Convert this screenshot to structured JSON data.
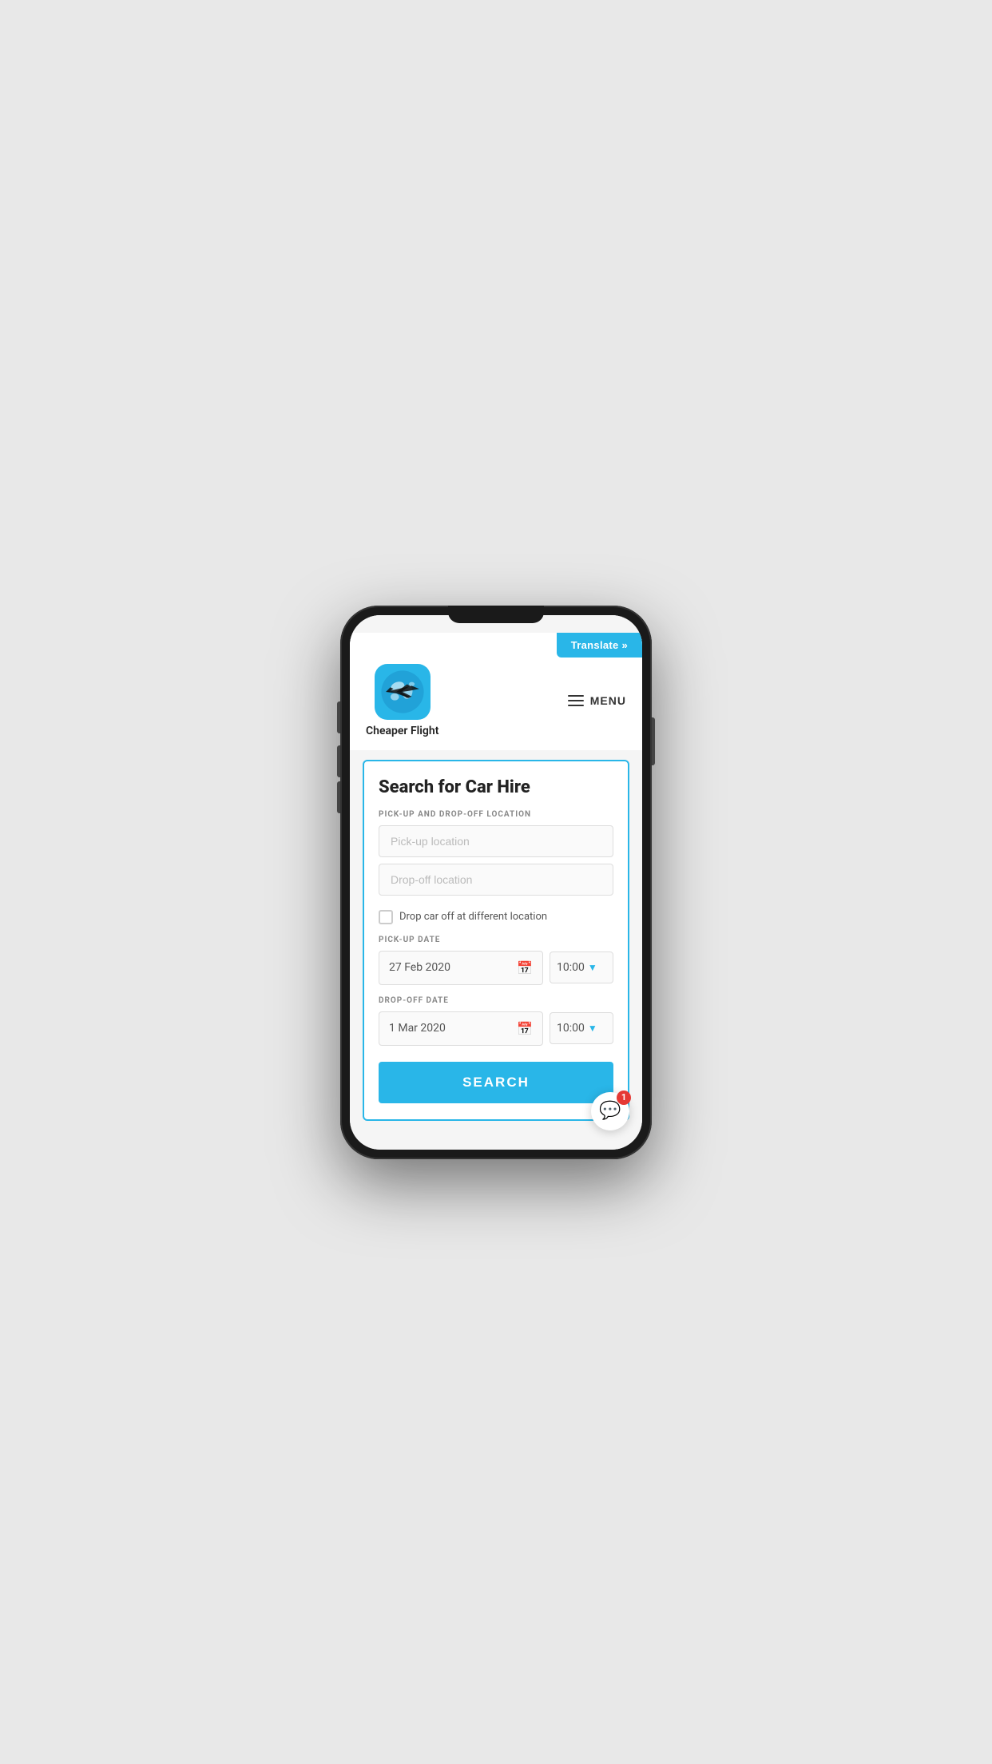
{
  "translate_btn": "Translate »",
  "logo": {
    "text": "Cheaper Flight"
  },
  "menu": {
    "label": "MENU"
  },
  "card": {
    "title": "Search for Car Hire",
    "pickup_location_label": "PICK-UP AND DROP-OFF LOCATION",
    "pickup_placeholder": "Pick-up location",
    "dropoff_placeholder": "Drop-off location",
    "different_location_label": "Drop car off at different location",
    "pickup_date_label": "PICK-UP DATE",
    "pickup_date_value": "27 Feb 2020",
    "pickup_time_value": "10:00",
    "dropoff_date_label": "DROP-OFF DATE",
    "dropoff_date_value": "1 Mar 2020",
    "dropoff_time_value": "10:00",
    "search_btn": "SEARCH"
  },
  "chat": {
    "badge": "1"
  },
  "colors": {
    "primary": "#29b6e8",
    "danger": "#e53935",
    "text_dark": "#222",
    "text_gray": "#888"
  }
}
